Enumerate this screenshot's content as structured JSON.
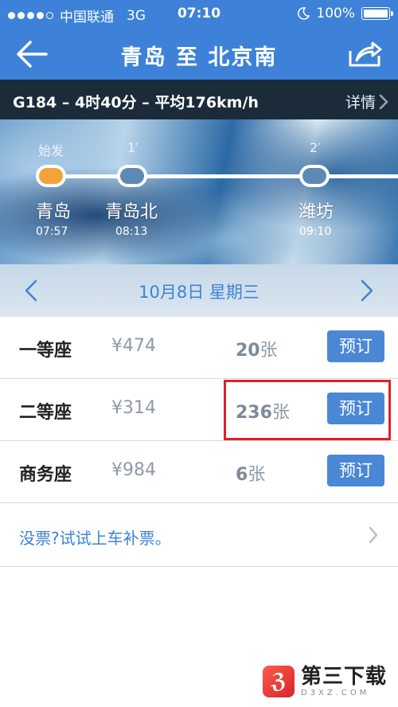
{
  "status": {
    "carrier": "中国联通",
    "network": "3G",
    "time": "07:10",
    "battery": "100%"
  },
  "nav": {
    "title": "青岛 至 北京南",
    "back_icon": "back-arrow-icon",
    "share_icon": "share-icon"
  },
  "train": {
    "info": "G184 – 4时40分 – 平均176km/h",
    "detail_label": "详情"
  },
  "route": {
    "stops": [
      {
        "top_label": "始发",
        "name": "青岛",
        "time": "07:57",
        "origin": true
      },
      {
        "top_label": "1′",
        "name": "青岛北",
        "time": "08:13",
        "origin": false
      },
      {
        "top_label": "2′",
        "name": "潍坊",
        "time": "09:10",
        "origin": false
      }
    ]
  },
  "date_nav": {
    "date": "10月8日 星期三"
  },
  "seats": [
    {
      "type": "一等座",
      "price": "¥474",
      "count": "20",
      "unit": "张",
      "book_label": "预订"
    },
    {
      "type": "二等座",
      "price": "¥314",
      "count": "236",
      "unit": "张",
      "book_label": "预订"
    },
    {
      "type": "商务座",
      "price": "¥984",
      "count": "6",
      "unit": "张",
      "book_label": "预订"
    }
  ],
  "no_ticket": {
    "text": "没票?试试上车补票。"
  },
  "watermark": {
    "logo_char": "ℨ",
    "main": "第三下载",
    "sub": "D3XZ.COM"
  },
  "colors": {
    "primary": "#3d82d8",
    "dark_bar": "#1b2b3a",
    "book_button": "#4a88d6",
    "origin_stop": "#f2a33a",
    "highlight": "#e0202a"
  }
}
